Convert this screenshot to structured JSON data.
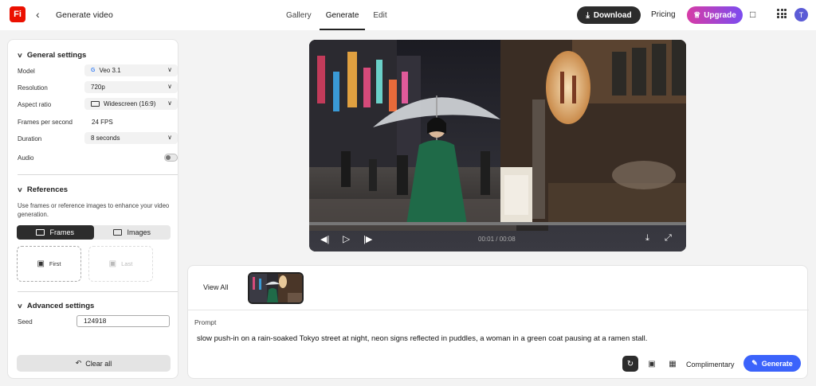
{
  "app": {
    "logo_text": "Fi",
    "title": "Generate video",
    "back_icon": "arrow-left-icon"
  },
  "nav": {
    "tabs": [
      {
        "label": "Gallery"
      },
      {
        "label": "Generate",
        "active": true
      },
      {
        "label": "Edit"
      }
    ]
  },
  "header": {
    "download_label": "Download",
    "pricing_label": "Pricing",
    "upgrade_label": "Upgrade",
    "avatar_initial": "T"
  },
  "general": {
    "heading": "General settings",
    "rows": {
      "model": {
        "label": "Model",
        "value": "Veo 3.1"
      },
      "resolution": {
        "label": "Resolution",
        "value": "720p"
      },
      "aspect": {
        "label": "Aspect ratio",
        "value": "Widescreen (16:9)"
      },
      "fps": {
        "label": "Frames per second",
        "value": "24 FPS"
      },
      "duration": {
        "label": "Duration",
        "value": "8 seconds"
      },
      "audio": {
        "label": "Audio",
        "enabled": false
      }
    }
  },
  "references": {
    "heading": "References",
    "description": "Use frames or reference images to enhance your video generation.",
    "seg_frames": "Frames",
    "seg_images": "Images",
    "first_label": "First",
    "last_label": "Last"
  },
  "advanced": {
    "heading": "Advanced settings",
    "seed_label": "Seed",
    "seed_value": "124918"
  },
  "clear_all_label": "Clear all",
  "player": {
    "time": "00:01 / 00:08",
    "progress": 0.0
  },
  "composer": {
    "view_all_label": "View All",
    "prompt_label": "Prompt",
    "prompt_text": "slow push-in on a rain-soaked Tokyo street at night, neon signs reflected in puddles, a woman in a green coat pausing at a ramen stall.",
    "complimentary_label": "Complimentary",
    "generate_label": "Generate"
  },
  "colors": {
    "accent": "#3b63fb",
    "brand": "#eb1000",
    "dark_button": "#2c2c2c",
    "upgrade_start": "#d73ba6",
    "upgrade_end": "#7b4cf0"
  }
}
